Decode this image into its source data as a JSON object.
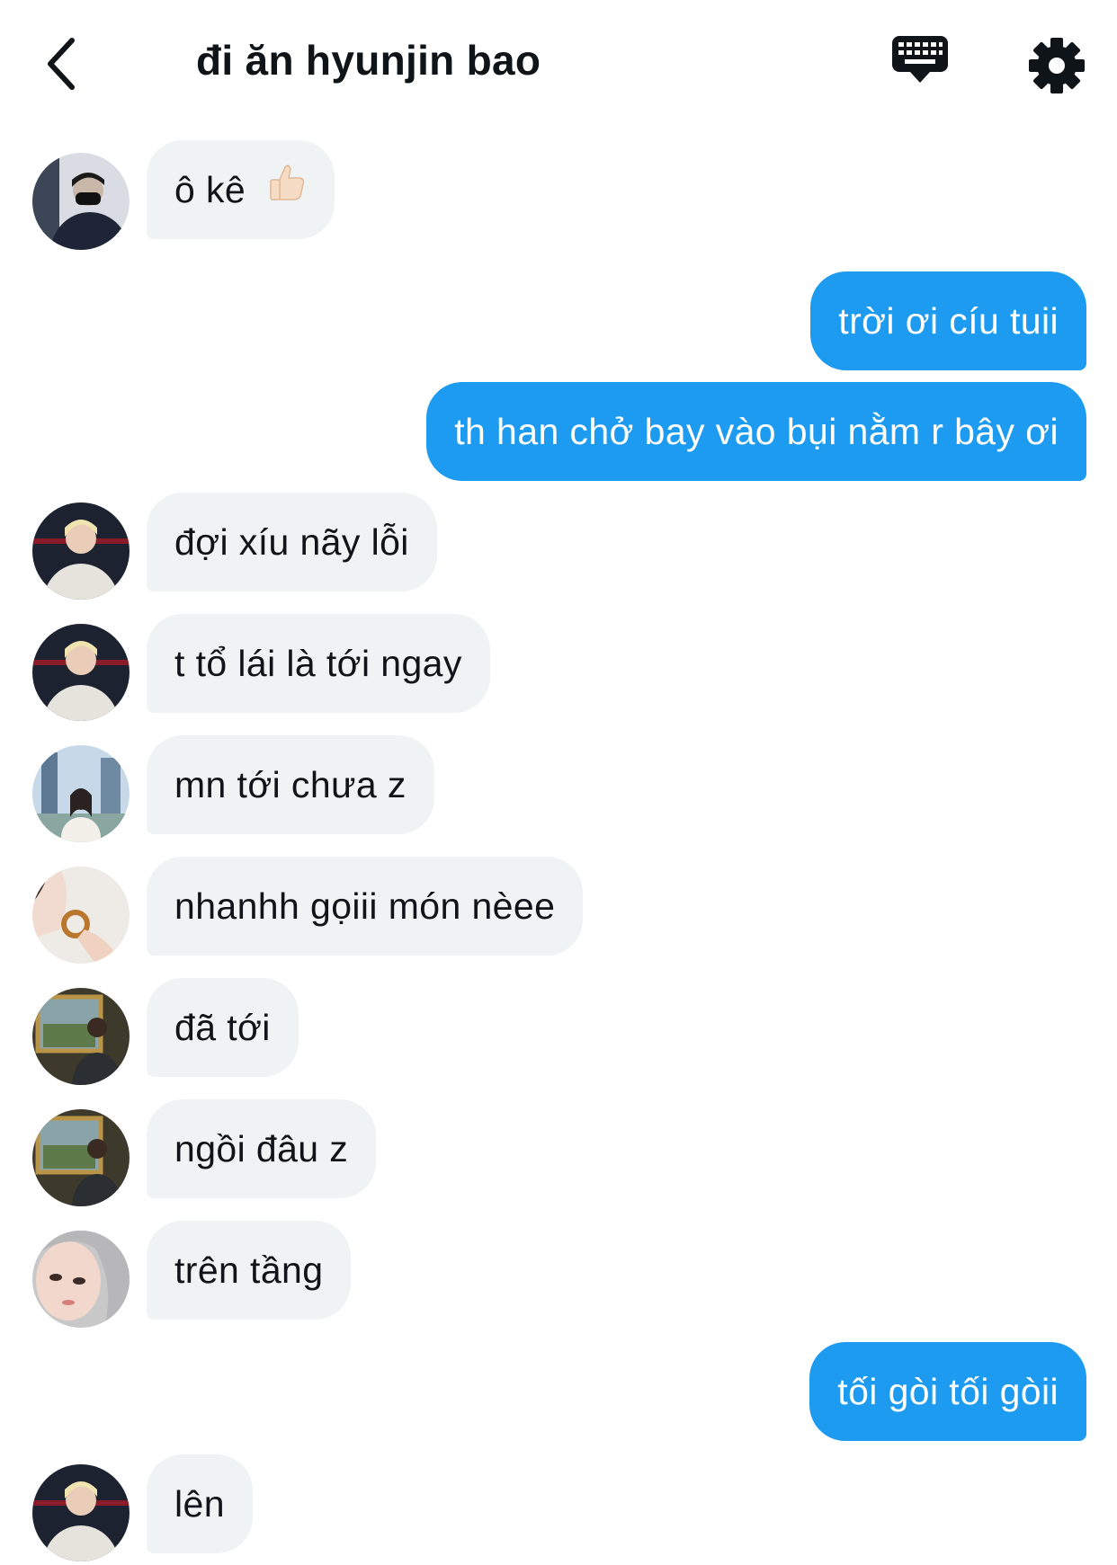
{
  "header": {
    "title": "đi ăn hyunjin bao",
    "back_icon": "chevron-left-icon",
    "keyboard_icon": "keyboard-icon",
    "settings_icon": "gear-icon"
  },
  "colors": {
    "outgoing_bubble": "#1d9bf0",
    "incoming_bubble": "#eff3f4",
    "text": "#0f1419"
  },
  "messages": [
    {
      "direction": "in",
      "text": "ô kê",
      "emoji": "thumbs-up-icon",
      "avatar": "avatar-masked-man"
    },
    {
      "direction": "out",
      "text": "trời ơi cíu tuii"
    },
    {
      "direction": "out",
      "text": "th han chở bay vào bụi nằm r bây ơi"
    },
    {
      "direction": "in",
      "text": "đợi xíu nãy lỗi",
      "avatar": "avatar-blond-man"
    },
    {
      "direction": "in",
      "text": "t tổ lái là tới ngay",
      "avatar": "avatar-blond-man"
    },
    {
      "direction": "in",
      "text": "mn tới chưa z",
      "avatar": "avatar-girl-city"
    },
    {
      "direction": "in",
      "text": "nhanhh gọiii món nèee",
      "avatar": "avatar-girl-pretzel"
    },
    {
      "direction": "in",
      "text": "đã tới",
      "avatar": "avatar-man-painting"
    },
    {
      "direction": "in",
      "text": "ngồi đâu z",
      "avatar": "avatar-man-painting"
    },
    {
      "direction": "in",
      "text": "trên tầng",
      "avatar": "avatar-hoodie-face"
    },
    {
      "direction": "out",
      "text": "tối gòi tối gòii"
    },
    {
      "direction": "in",
      "text": "lên",
      "avatar": "avatar-blond-man"
    }
  ]
}
